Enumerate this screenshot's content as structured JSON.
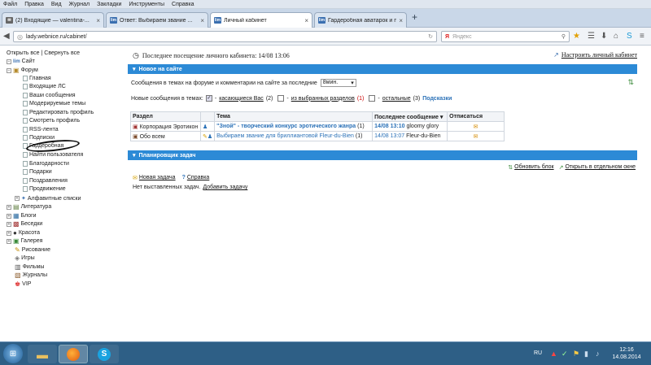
{
  "menu": [
    "Файл",
    "Правка",
    "Вид",
    "Журнал",
    "Закладки",
    "Инструменты",
    "Справка"
  ],
  "tabs": [
    {
      "label": "(2) Входящие — valentina-..."
    },
    {
      "label": "Ответ: Выбираем звание ..."
    },
    {
      "label": "Личный кабинет"
    },
    {
      "label": "Гардеробная аватарок и п..."
    }
  ],
  "new_tab": "+",
  "url": "lady.webnice.ru/cabinet/",
  "search_placeholder": "Яндекс",
  "sidebar": {
    "open_all": "Открыть все",
    "sep": "|",
    "close_all": "Свернуть все",
    "root": "Сайт",
    "forum": "Форум",
    "forum_items": [
      "Главная",
      "Входящие ЛС",
      "Ваши сообщения",
      "Модерируемые темы",
      "Редактировать профиль",
      "Смотреть профиль",
      "RSS-лента",
      "Подписки",
      "Гардеробная",
      "Найти пользователя",
      "Благодарности",
      "Подарки",
      "Поздравления",
      "Продвижение"
    ],
    "alpha": "Алфавитные списки",
    "sections": [
      "Литература",
      "Блоги",
      "Беседки",
      "Красота",
      "Галерея"
    ],
    "leaves": [
      "Рисование",
      "Игры",
      "Фильмы",
      "Журналы",
      "VIP"
    ]
  },
  "main": {
    "last_visit": "Последнее посещение личного кабинета: 14/08 13:06",
    "customize": "Настроить личный кабинет",
    "new_header": "Новое на сайте",
    "msgs_prefix": "Сообщения в темах на форуме и комментарии на сайте за последние",
    "period": "8мин.",
    "new_in_topics": "Новые сообщения в темах:",
    "f1_label": "касающиеся Вас",
    "f1_count": "(2)",
    "f2_label": "из выбранных разделов",
    "f2_count": "(1)",
    "f3_label": "остальные",
    "f3_count": "(3)",
    "hints": "Подсказки",
    "dash": "-",
    "columns": [
      "Раздел",
      "Тема",
      "Последнее сообщение",
      "Отписаться"
    ],
    "rows": [
      {
        "section": "Корпорация Эротикон",
        "topic": "\"Зной\" - творческий конкурс эротического жанра",
        "count": "(1)",
        "date": "14/08 13:10",
        "author": "gloomy glory"
      },
      {
        "section": "Обо всем",
        "topic": "Выбираем звание для бриллиантовой Fleur-du-Bien",
        "count": "(1)",
        "date": "14/08 13:07",
        "author": "Fleur-du-Bien"
      }
    ],
    "planner_header": "Планировщик задач",
    "refresh": "Обновить блок",
    "open_window": "Открыть в отдельном окне",
    "new_task": "Новая задача",
    "help": "Справка",
    "no_tasks": "Нет выставленных задач.",
    "add_task": "Добавить задачу"
  },
  "taskbar": {
    "lang": "RU",
    "time": "12:16",
    "date": "14.08.2014"
  },
  "colors": {
    "section_bar": "#2c8ad6",
    "link": "#1c4f8f",
    "taskbar": "#2e5f86"
  }
}
